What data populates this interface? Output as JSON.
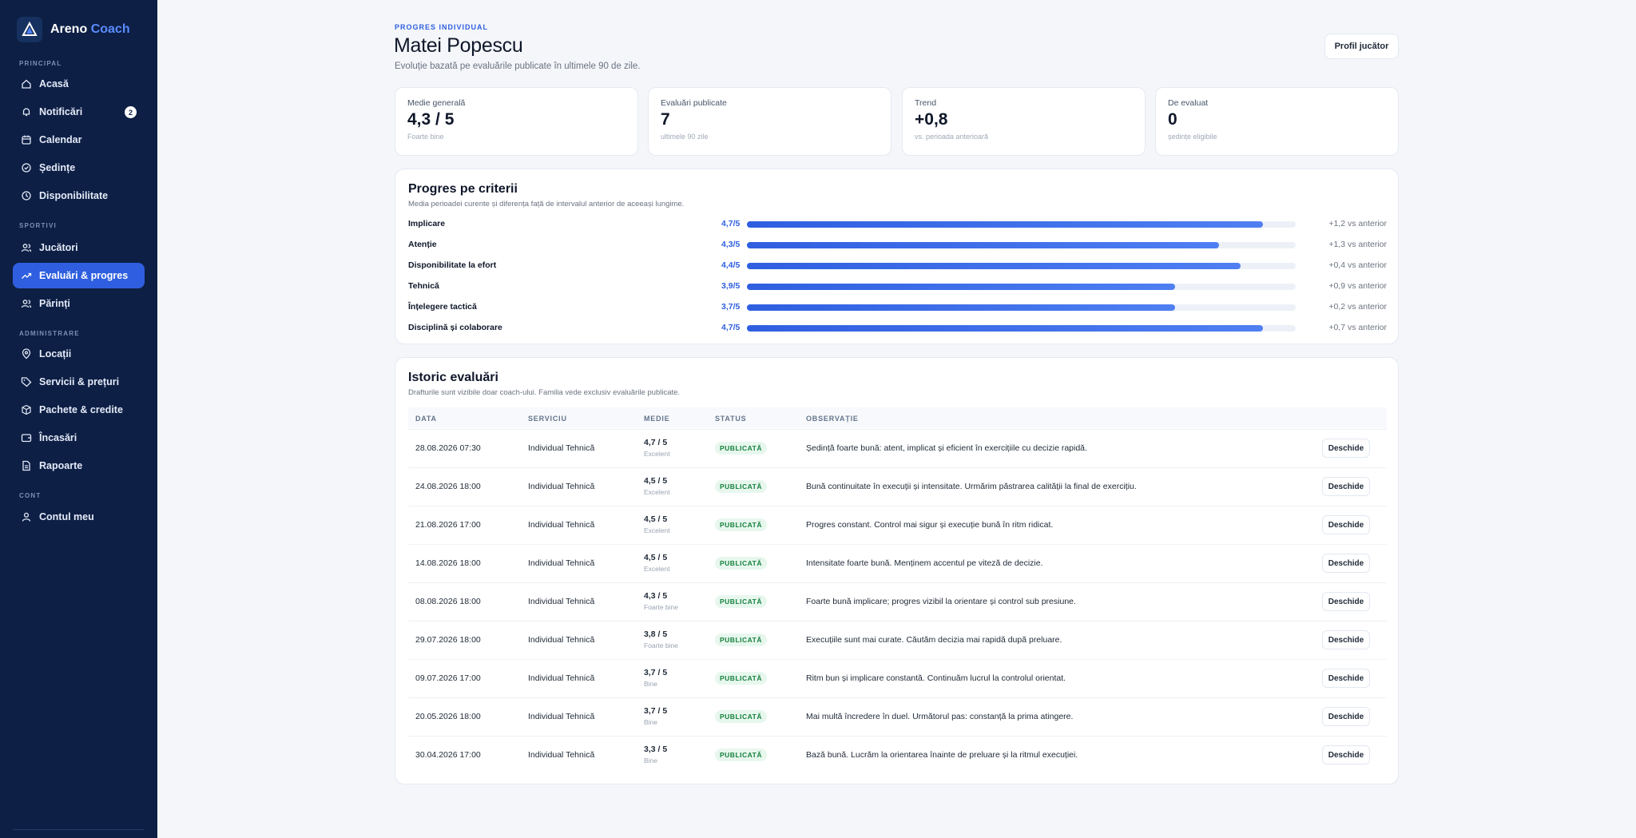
{
  "brand": {
    "name": "Areno",
    "accent": "Coach"
  },
  "sidebar": {
    "sections": [
      "PRINCIPAL",
      "SPORTIVI",
      "ADMINISTRARE",
      "CONT"
    ],
    "items": [
      {
        "label": "Acasă",
        "icon": "home-icon"
      },
      {
        "label": "Notificări",
        "icon": "bell-icon",
        "badge": "2"
      },
      {
        "label": "Calendar",
        "icon": "calendar-icon"
      },
      {
        "label": "Ședințe",
        "icon": "check-circle-icon"
      },
      {
        "label": "Disponibilitate",
        "icon": "clock-icon"
      },
      {
        "label": "Jucători",
        "icon": "users-icon"
      },
      {
        "label": "Evaluări & progres",
        "icon": "trending-up-icon",
        "active": true
      },
      {
        "label": "Părinți",
        "icon": "users-icon"
      },
      {
        "label": "Locații",
        "icon": "map-pin-icon"
      },
      {
        "label": "Servicii & prețuri",
        "icon": "tag-icon"
      },
      {
        "label": "Pachete & credite",
        "icon": "package-icon"
      },
      {
        "label": "Încasări",
        "icon": "wallet-icon"
      },
      {
        "label": "Rapoarte",
        "icon": "file-icon"
      },
      {
        "label": "Contul meu",
        "icon": "user-icon"
      }
    ]
  },
  "header": {
    "eyebrow": "PROGRES INDIVIDUAL",
    "title": "Matei Popescu",
    "subtitle": "Evoluție bazată pe evaluările publicate în ultimele 90 de zile.",
    "profile_button": "Profil jucător"
  },
  "stats": [
    {
      "label": "Medie generală",
      "value": "4,3 / 5",
      "hint": "Foarte bine"
    },
    {
      "label": "Evaluări publicate",
      "value": "7",
      "hint": "ultimele 90 zile"
    },
    {
      "label": "Trend",
      "value": "+0,8",
      "hint": "vs. perioada anterioară"
    },
    {
      "label": "De evaluat",
      "value": "0",
      "hint": "ședințe eligibile"
    }
  ],
  "criteria": {
    "title": "Progres pe criterii",
    "subtitle": "Media perioadei curente și diferența față de intervalul anterior de aceeași lungime.",
    "items": [
      {
        "name": "Implicare",
        "score": "4,7/5",
        "value": 4.7,
        "delta": "+1,2 vs anterior"
      },
      {
        "name": "Atenție",
        "score": "4,3/5",
        "value": 4.3,
        "delta": "+1,3 vs anterior"
      },
      {
        "name": "Disponibilitate la efort",
        "score": "4,4/5",
        "value": 4.5,
        "delta": "+0,4 vs anterior"
      },
      {
        "name": "Tehnică",
        "score": "3,9/5",
        "value": 3.9,
        "delta": "+0,9 vs anterior"
      },
      {
        "name": "Înțelegere tactică",
        "score": "3,7/5",
        "value": 3.9,
        "delta": "+0,2 vs anterior"
      },
      {
        "name": "Disciplină și colaborare",
        "score": "4,7/5",
        "value": 4.7,
        "delta": "+0,7 vs anterior"
      }
    ]
  },
  "history": {
    "title": "Istoric evaluări",
    "subtitle": "Drafturile sunt vizibile doar coach-ului. Familia vede exclusiv evaluările publicate.",
    "columns": [
      "DATA",
      "SERVICIU",
      "MEDIE",
      "STATUS",
      "OBSERVAȚIE"
    ],
    "open_label": "Deschide",
    "rows": [
      {
        "date": "28.08.2026 07:30",
        "service": "Individual Tehnică",
        "avg": "4,7 / 5",
        "avg_label": "Excelent",
        "status": "PUBLICATĂ",
        "note": "Ședință foarte bună: atent, implicat și eficient în exercițiile cu decizie rapidă."
      },
      {
        "date": "24.08.2026 18:00",
        "service": "Individual Tehnică",
        "avg": "4,5 / 5",
        "avg_label": "Excelent",
        "status": "PUBLICATĂ",
        "note": "Bună continuitate în execuții și intensitate. Urmărim păstrarea calității la final de exercițiu."
      },
      {
        "date": "21.08.2026 17:00",
        "service": "Individual Tehnică",
        "avg": "4,5 / 5",
        "avg_label": "Excelent",
        "status": "PUBLICATĂ",
        "note": "Progres constant. Control mai sigur și execuție bună în ritm ridicat."
      },
      {
        "date": "14.08.2026 18:00",
        "service": "Individual Tehnică",
        "avg": "4,5 / 5",
        "avg_label": "Excelent",
        "status": "PUBLICATĂ",
        "note": "Intensitate foarte bună. Menținem accentul pe viteză de decizie."
      },
      {
        "date": "08.08.2026 18:00",
        "service": "Individual Tehnică",
        "avg": "4,3 / 5",
        "avg_label": "Foarte bine",
        "status": "PUBLICATĂ",
        "note": "Foarte bună implicare; progres vizibil la orientare și control sub presiune."
      },
      {
        "date": "29.07.2026 18:00",
        "service": "Individual Tehnică",
        "avg": "3,8 / 5",
        "avg_label": "Foarte bine",
        "status": "PUBLICATĂ",
        "note": "Execuțiile sunt mai curate. Căutăm decizia mai rapidă după preluare."
      },
      {
        "date": "09.07.2026 17:00",
        "service": "Individual Tehnică",
        "avg": "3,7 / 5",
        "avg_label": "Bine",
        "status": "PUBLICATĂ",
        "note": "Ritm bun și implicare constantă. Continuăm lucrul la controlul orientat."
      },
      {
        "date": "20.05.2026 18:00",
        "service": "Individual Tehnică",
        "avg": "3,7 / 5",
        "avg_label": "Bine",
        "status": "PUBLICATĂ",
        "note": "Mai multă încredere în duel. Următorul pas: constanță la prima atingere."
      },
      {
        "date": "30.04.2026 17:00",
        "service": "Individual Tehnică",
        "avg": "3,3 / 5",
        "avg_label": "Bine",
        "status": "PUBLICATĂ",
        "note": "Bază bună. Lucrăm la orientarea înainte de preluare și la ritmul execuției."
      }
    ]
  },
  "colors": {
    "sidebar": "#0d1f45",
    "accent": "#2f5fe0",
    "success": "#16803c"
  }
}
